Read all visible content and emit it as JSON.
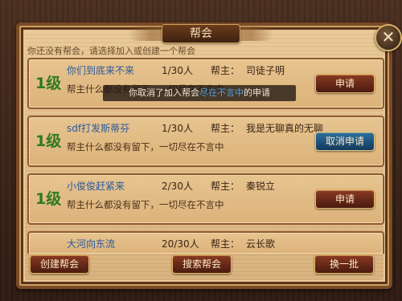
{
  "dialog": {
    "title": "帮会",
    "close_glyph": "✕",
    "hint": "你还没有帮会，请选择加入或创建一个帮会"
  },
  "guilds": [
    {
      "level": "1级",
      "name": "你们到底来不来",
      "count": "1/30人",
      "leader_label": "帮主：",
      "leader": "司徒子明",
      "desc": "帮主什么都没有留下，一切尽在不言中",
      "action": "申请"
    },
    {
      "level": "1级",
      "name": "sdf打发斯蒂芬",
      "count": "1/30人",
      "leader_label": "帮主：",
      "leader": "我是无聊真的无聊",
      "desc": "帮主什么都没有留下，一切尽在不言中",
      "action": "取消申请"
    },
    {
      "level": "1级",
      "name": "小俊俊赶紧来",
      "count": "2/30人",
      "leader_label": "帮主：",
      "leader": "秦锐立",
      "desc": "帮主什么都没有留下，一切尽在不言中",
      "action": "申请"
    },
    {
      "level": "",
      "name": "大河向东流",
      "count": "20/30人",
      "leader_label": "帮主：",
      "leader": "云长歌",
      "desc": "",
      "action": ""
    }
  ],
  "toast": {
    "prefix": "你取消了加入帮会",
    "highlight": "尽在不言中",
    "suffix": "的申请"
  },
  "footer": {
    "create": "创建帮会",
    "search": "搜索帮会",
    "refresh": "换一批"
  }
}
